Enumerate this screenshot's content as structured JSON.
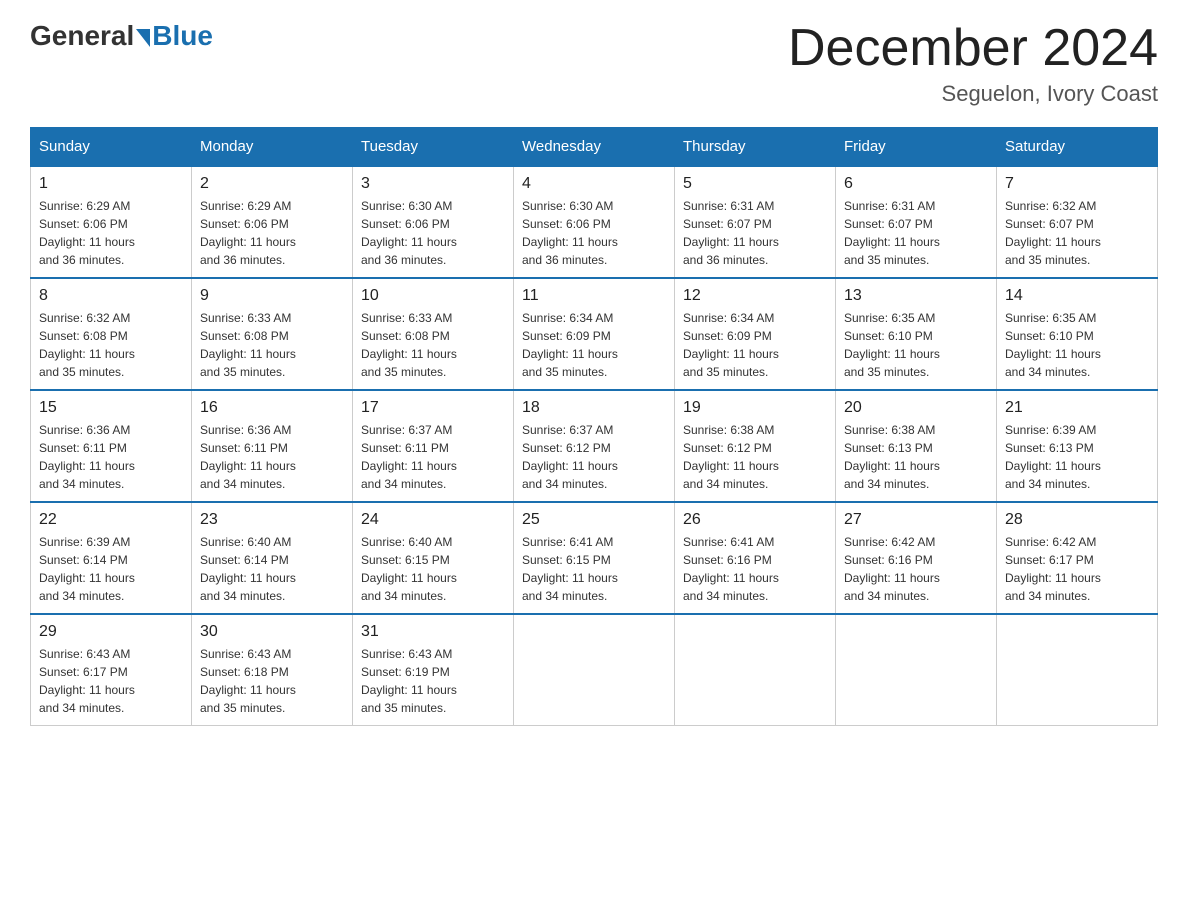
{
  "header": {
    "logo_general": "General",
    "logo_blue": "Blue",
    "month_title": "December 2024",
    "location": "Seguelon, Ivory Coast"
  },
  "columns": [
    "Sunday",
    "Monday",
    "Tuesday",
    "Wednesday",
    "Thursday",
    "Friday",
    "Saturday"
  ],
  "weeks": [
    [
      {
        "date": "1",
        "sunrise": "6:29 AM",
        "sunset": "6:06 PM",
        "daylight": "11 hours and 36 minutes."
      },
      {
        "date": "2",
        "sunrise": "6:29 AM",
        "sunset": "6:06 PM",
        "daylight": "11 hours and 36 minutes."
      },
      {
        "date": "3",
        "sunrise": "6:30 AM",
        "sunset": "6:06 PM",
        "daylight": "11 hours and 36 minutes."
      },
      {
        "date": "4",
        "sunrise": "6:30 AM",
        "sunset": "6:06 PM",
        "daylight": "11 hours and 36 minutes."
      },
      {
        "date": "5",
        "sunrise": "6:31 AM",
        "sunset": "6:07 PM",
        "daylight": "11 hours and 36 minutes."
      },
      {
        "date": "6",
        "sunrise": "6:31 AM",
        "sunset": "6:07 PM",
        "daylight": "11 hours and 35 minutes."
      },
      {
        "date": "7",
        "sunrise": "6:32 AM",
        "sunset": "6:07 PM",
        "daylight": "11 hours and 35 minutes."
      }
    ],
    [
      {
        "date": "8",
        "sunrise": "6:32 AM",
        "sunset": "6:08 PM",
        "daylight": "11 hours and 35 minutes."
      },
      {
        "date": "9",
        "sunrise": "6:33 AM",
        "sunset": "6:08 PM",
        "daylight": "11 hours and 35 minutes."
      },
      {
        "date": "10",
        "sunrise": "6:33 AM",
        "sunset": "6:08 PM",
        "daylight": "11 hours and 35 minutes."
      },
      {
        "date": "11",
        "sunrise": "6:34 AM",
        "sunset": "6:09 PM",
        "daylight": "11 hours and 35 minutes."
      },
      {
        "date": "12",
        "sunrise": "6:34 AM",
        "sunset": "6:09 PM",
        "daylight": "11 hours and 35 minutes."
      },
      {
        "date": "13",
        "sunrise": "6:35 AM",
        "sunset": "6:10 PM",
        "daylight": "11 hours and 35 minutes."
      },
      {
        "date": "14",
        "sunrise": "6:35 AM",
        "sunset": "6:10 PM",
        "daylight": "11 hours and 34 minutes."
      }
    ],
    [
      {
        "date": "15",
        "sunrise": "6:36 AM",
        "sunset": "6:11 PM",
        "daylight": "11 hours and 34 minutes."
      },
      {
        "date": "16",
        "sunrise": "6:36 AM",
        "sunset": "6:11 PM",
        "daylight": "11 hours and 34 minutes."
      },
      {
        "date": "17",
        "sunrise": "6:37 AM",
        "sunset": "6:11 PM",
        "daylight": "11 hours and 34 minutes."
      },
      {
        "date": "18",
        "sunrise": "6:37 AM",
        "sunset": "6:12 PM",
        "daylight": "11 hours and 34 minutes."
      },
      {
        "date": "19",
        "sunrise": "6:38 AM",
        "sunset": "6:12 PM",
        "daylight": "11 hours and 34 minutes."
      },
      {
        "date": "20",
        "sunrise": "6:38 AM",
        "sunset": "6:13 PM",
        "daylight": "11 hours and 34 minutes."
      },
      {
        "date": "21",
        "sunrise": "6:39 AM",
        "sunset": "6:13 PM",
        "daylight": "11 hours and 34 minutes."
      }
    ],
    [
      {
        "date": "22",
        "sunrise": "6:39 AM",
        "sunset": "6:14 PM",
        "daylight": "11 hours and 34 minutes."
      },
      {
        "date": "23",
        "sunrise": "6:40 AM",
        "sunset": "6:14 PM",
        "daylight": "11 hours and 34 minutes."
      },
      {
        "date": "24",
        "sunrise": "6:40 AM",
        "sunset": "6:15 PM",
        "daylight": "11 hours and 34 minutes."
      },
      {
        "date": "25",
        "sunrise": "6:41 AM",
        "sunset": "6:15 PM",
        "daylight": "11 hours and 34 minutes."
      },
      {
        "date": "26",
        "sunrise": "6:41 AM",
        "sunset": "6:16 PM",
        "daylight": "11 hours and 34 minutes."
      },
      {
        "date": "27",
        "sunrise": "6:42 AM",
        "sunset": "6:16 PM",
        "daylight": "11 hours and 34 minutes."
      },
      {
        "date": "28",
        "sunrise": "6:42 AM",
        "sunset": "6:17 PM",
        "daylight": "11 hours and 34 minutes."
      }
    ],
    [
      {
        "date": "29",
        "sunrise": "6:43 AM",
        "sunset": "6:17 PM",
        "daylight": "11 hours and 34 minutes."
      },
      {
        "date": "30",
        "sunrise": "6:43 AM",
        "sunset": "6:18 PM",
        "daylight": "11 hours and 35 minutes."
      },
      {
        "date": "31",
        "sunrise": "6:43 AM",
        "sunset": "6:19 PM",
        "daylight": "11 hours and 35 minutes."
      },
      null,
      null,
      null,
      null
    ]
  ],
  "labels": {
    "sunrise": "Sunrise:",
    "sunset": "Sunset:",
    "daylight": "Daylight:"
  }
}
